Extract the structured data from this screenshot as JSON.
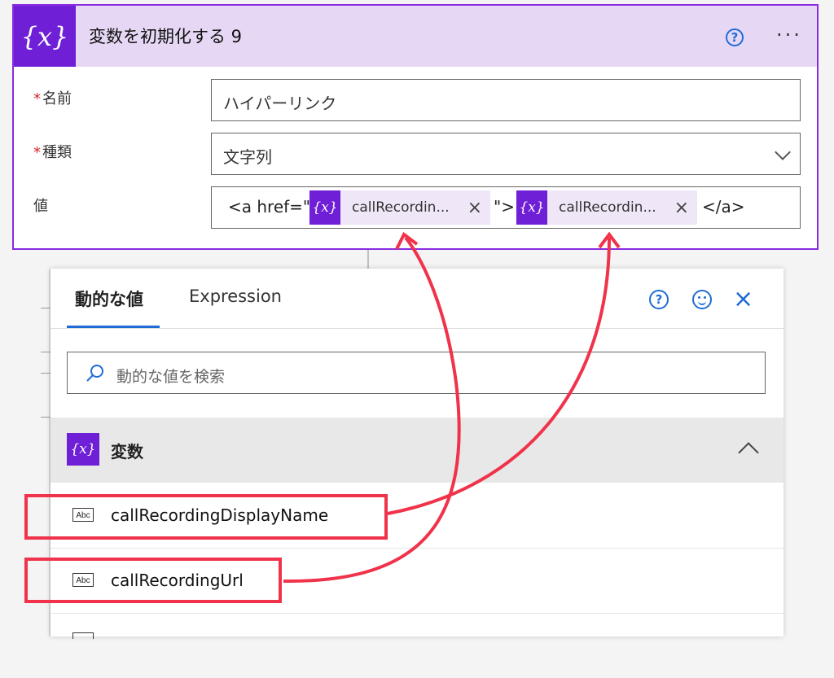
{
  "card": {
    "title": "変数を初期化する 9",
    "logo": "{x}",
    "help": "?",
    "more": "···",
    "name_label": "名前",
    "name_value": "ハイパーリンク",
    "type_label": "種類",
    "type_value": "文字列",
    "value_label": "値",
    "required_mark": "*",
    "value_parts": {
      "prefix": "<a href=\"",
      "token1": "callRecordin...",
      "middle": "\">",
      "token2": "callRecordin...",
      "suffix": "</a>",
      "token_icon": "{x}",
      "token_close": "×"
    }
  },
  "panel": {
    "tab_dynamic": "動的な値",
    "tab_expression": "Expression",
    "help": "?",
    "close": "×",
    "search_placeholder": "動的な値を検索",
    "section_title": "変数",
    "section_icon": "{x}",
    "items": [
      {
        "icon": "Abc",
        "label": "callRecordingDisplayName"
      },
      {
        "icon": "Abc",
        "label": "callRecordingUrl"
      }
    ]
  },
  "colors": {
    "accent_purple": "#6f1fd6",
    "header_bg": "#e6d8f5",
    "link_blue": "#1f6cd6",
    "annotation_red": "#f0334a"
  }
}
